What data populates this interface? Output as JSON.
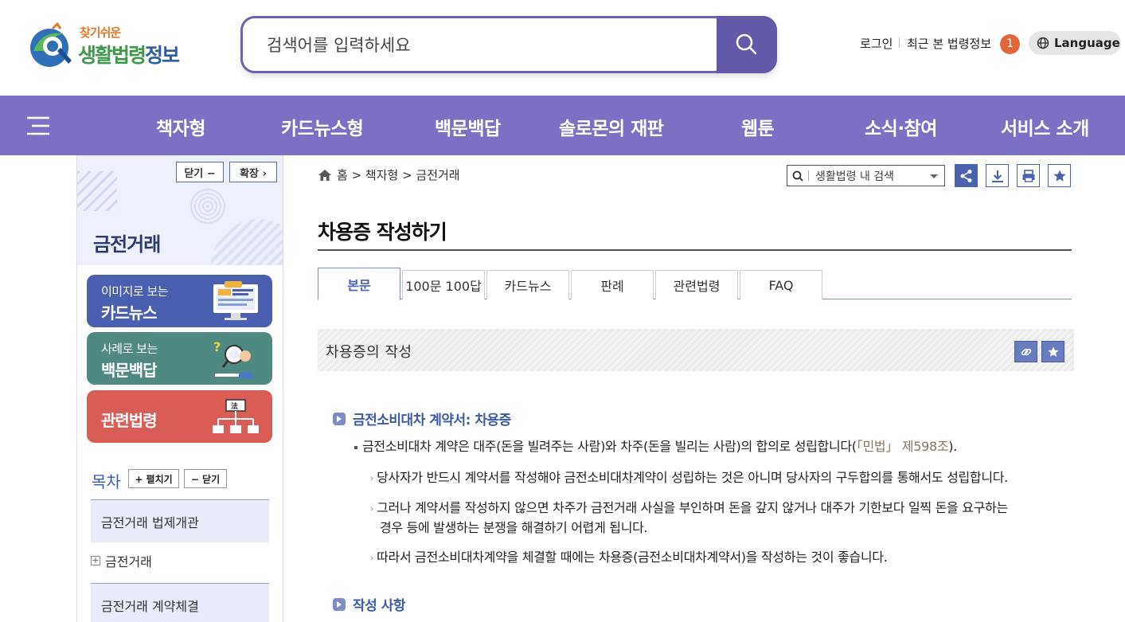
{
  "header": {
    "logo_small": "찾기쉬운",
    "logo_big_a": "생활법령",
    "logo_big_b": "정보",
    "search_placeholder": "검색어를 입력하세요",
    "login": "로그인",
    "recent": "최근 본 법령정보",
    "recent_count": "1",
    "language": "Language"
  },
  "nav": {
    "items": [
      "책자형",
      "카드뉴스형",
      "백문백답",
      "솔로몬의 재판",
      "웹툰",
      "소식·참여",
      "서비스 소개"
    ]
  },
  "sidebar": {
    "close_btn": "닫기 −",
    "expand_btn": "확장 ›",
    "title": "금전거래",
    "quick": [
      {
        "small": "이미지로 보는",
        "big": "카드뉴스",
        "color": "#4a5fb0"
      },
      {
        "small": "사례로 보는",
        "big": "백문백답",
        "color": "#4e8a82"
      },
      {
        "big": "관련법령",
        "color": "#d95c55"
      }
    ],
    "toc_label": "목차",
    "toc_open": "+ 펼치기",
    "toc_close": "− 닫기",
    "toc_items": [
      "금전거래 법제개관",
      "금전거래",
      "금전거래 계약체결"
    ]
  },
  "main": {
    "breadcrumb": "홈 > 책자형 > 금전거래",
    "mini_search": "생활법령 내 검색",
    "title": "차용증 작성하기",
    "tabs": [
      "본문",
      "100문 100답",
      "카드뉴스",
      "판례",
      "관련법령",
      "FAQ"
    ],
    "section_title": "차용증의 작성",
    "subheading1": "금전소비대차 계약서: 차용증",
    "p1_text": "금전소비대차 계약은 대주(돈을 빌려주는 사람)와 차주(돈을 빌리는 사람)의 합의로 성립합니다(",
    "p1_ref": "「민법」 제598조",
    "p1_end": ").",
    "p2": "당사자가 반드시 계약서를 작성해야 금전소비대차계약이 성립하는 것은 아니며 당사자의 구두합의를 통해서도 성립합니다.",
    "p3_line1": "그러나 계약서를 작성하지 않으면 차주가 금전거래 사실을 부인하며 돈을 갚지 않거나 대주가 기한보다 일찍 돈을 요구하는",
    "p3_line2": "경우 등에 발생하는 분쟁을 해결하기 어렵게 됩니다.",
    "p4": "따라서 금전소비대차계약을 체결할 때에는 차용증(금전소비대차계약서)을 작성하는 것이 좋습니다.",
    "subheading2": "작성 사항"
  },
  "colors": {
    "nav_bg": "#7c70c5",
    "search_border": "#6b62b4",
    "accent_blue": "#4a63b0"
  }
}
